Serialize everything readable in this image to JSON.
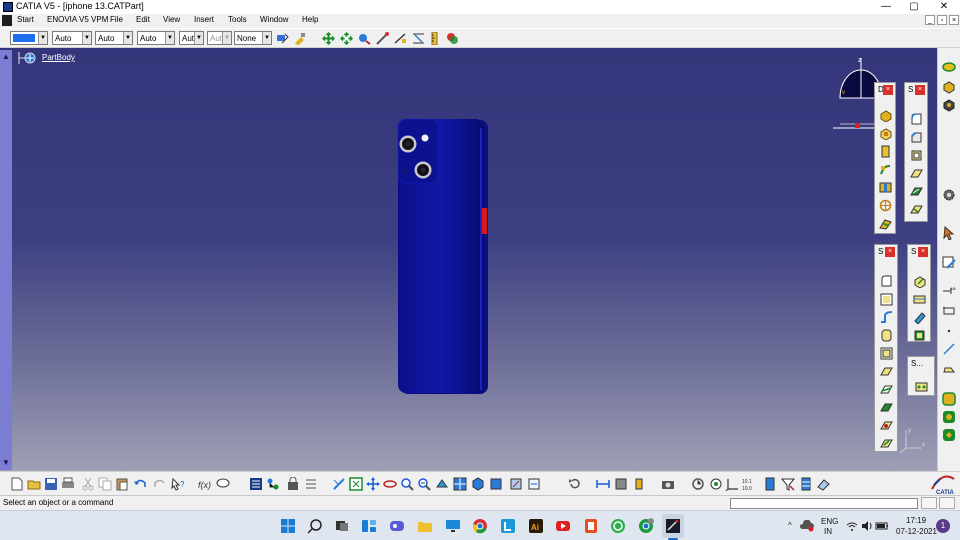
{
  "window": {
    "title": "CATIA V5 - [iphone 13.CATPart]",
    "controls": {
      "minimize": "—",
      "maximize": "▢",
      "close": "✕"
    }
  },
  "menubar": {
    "items": [
      "Start",
      "ENOVIA V5 VPM",
      "File",
      "Edit",
      "View",
      "Insert",
      "Tools",
      "Window",
      "Help"
    ],
    "mdi_controls": [
      "_",
      "▫",
      "×"
    ]
  },
  "toolbar": {
    "color_swatch": "#1e6ff0",
    "combos": [
      "Auto",
      "Auto",
      "Auto",
      "Aut",
      "Aut",
      "None"
    ]
  },
  "tree": {
    "root_label": "PartBody"
  },
  "floating_toolbars": [
    {
      "title": "D",
      "icon_count": 7
    },
    {
      "title": "S",
      "icon_count": 6
    },
    {
      "title": "S",
      "icon_count": 11
    },
    {
      "title": "S",
      "icon_count": 4
    },
    {
      "title": "S...",
      "icon_count": 1
    }
  ],
  "status": {
    "message": "Select an object or a command"
  },
  "taskbar": {
    "tray": {
      "language_top": "ENG",
      "language_bottom": "IN",
      "time": "17:19",
      "date": "07-12-2021",
      "notification_count": "1"
    }
  },
  "model": {
    "body_color": "#0f14a0",
    "accent_red": "#d8181a"
  },
  "compass": {
    "axis_label": "z"
  },
  "axis_triad": {
    "y_label": "y",
    "x_label": "x"
  }
}
